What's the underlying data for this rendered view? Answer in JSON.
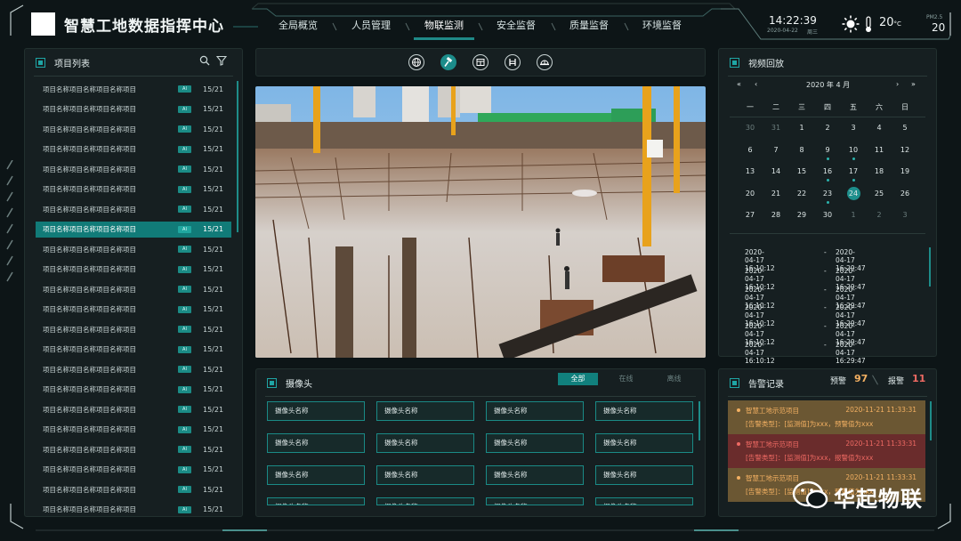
{
  "header": {
    "title": "智慧工地数据指挥中心",
    "nav": [
      "全局概览",
      "人员管理",
      "物联监测",
      "安全监督",
      "质量监督",
      "环境监督"
    ],
    "active_nav": "物联监测",
    "time": "14:22:39",
    "date": "2020-04-22",
    "weekday": "周三",
    "temperature": "20",
    "temp_unit": "°C",
    "pm_label": "PM2.5",
    "pm_value": "20",
    "icons": {
      "weather": "sun-icon",
      "temperature": "thermometer-icon"
    }
  },
  "project_list": {
    "title": "项目列表",
    "icons": [
      "search-icon",
      "filter-icon"
    ],
    "items": [
      {
        "name": "项目名称项目名称项目名称项目",
        "tag": "AI",
        "count": "15/21"
      },
      {
        "name": "项目名称项目名称项目名称项目",
        "tag": "AI",
        "count": "15/21"
      },
      {
        "name": "项目名称项目名称项目名称项目",
        "tag": "AI",
        "count": "15/21"
      },
      {
        "name": "项目名称项目名称项目名称项目",
        "tag": "AI",
        "count": "15/21"
      },
      {
        "name": "项目名称项目名称项目名称项目",
        "tag": "AI",
        "count": "15/21"
      },
      {
        "name": "项目名称项目名称项目名称项目",
        "tag": "AI",
        "count": "15/21"
      },
      {
        "name": "项目名称项目名称项目名称项目",
        "tag": "AI",
        "count": "15/21"
      },
      {
        "name": "项目名称项目名称项目名称项目",
        "tag": "AI",
        "count": "15/21",
        "selected": true
      },
      {
        "name": "项目名称项目名称项目名称项目",
        "tag": "AI",
        "count": "15/21"
      },
      {
        "name": "项目名称项目名称项目名称项目",
        "tag": "AI",
        "count": "15/21"
      },
      {
        "name": "项目名称项目名称项目名称项目",
        "tag": "AI",
        "count": "15/21"
      },
      {
        "name": "项目名称项目名称项目名称项目",
        "tag": "AI",
        "count": "15/21"
      },
      {
        "name": "项目名称项目名称项目名称项目",
        "tag": "AI",
        "count": "15/21"
      },
      {
        "name": "项目名称项目名称项目名称项目",
        "tag": "AI",
        "count": "15/21"
      },
      {
        "name": "项目名称项目名称项目名称项目",
        "tag": "AI",
        "count": "15/21"
      },
      {
        "name": "项目名称项目名称项目名称项目",
        "tag": "AI",
        "count": "15/21"
      },
      {
        "name": "项目名称项目名称项目名称项目",
        "tag": "AI",
        "count": "15/21"
      },
      {
        "name": "项目名称项目名称项目名称项目",
        "tag": "AI",
        "count": "15/21"
      },
      {
        "name": "项目名称项目名称项目名称项目",
        "tag": "AI",
        "count": "15/21"
      },
      {
        "name": "项目名称项目名称项目名称项目",
        "tag": "AI",
        "count": "15/21"
      },
      {
        "name": "项目名称项目名称项目名称项目",
        "tag": "AI",
        "count": "15/21"
      },
      {
        "name": "项目名称项目名称项目名称项目",
        "tag": "AI",
        "count": "15/21"
      }
    ]
  },
  "toolbar": {
    "buttons": [
      "globe-icon",
      "hammer-icon",
      "panel-icon",
      "barrier-icon",
      "helmet-icon"
    ],
    "active": "hammer-icon"
  },
  "video_replay": {
    "title": "视频回放",
    "month_label": "2020 年 4 月",
    "weekdays": [
      "一",
      "二",
      "三",
      "四",
      "五",
      "六",
      "日"
    ],
    "weeks": [
      [
        "30",
        "31",
        "1",
        "2",
        "3",
        "4",
        "5"
      ],
      [
        "6",
        "7",
        "8",
        "9",
        "10",
        "11",
        "12"
      ],
      [
        "13",
        "14",
        "15",
        "16",
        "17",
        "18",
        "19"
      ],
      [
        "20",
        "21",
        "22",
        "23",
        "24",
        "25",
        "26"
      ],
      [
        "27",
        "28",
        "29",
        "30",
        "1",
        "2",
        "3"
      ]
    ],
    "today": "24",
    "records": [
      {
        "start": "2020-04-17  16:10:12",
        "sep": "-",
        "end": "2020-04-17  16:29:47"
      },
      {
        "start": "2020-04-17  16:10:12",
        "sep": "-",
        "end": "2020-04-17  16:29:47"
      },
      {
        "start": "2020-04-17  16:10:12",
        "sep": "-",
        "end": "2020-04-17  16:29:47"
      },
      {
        "start": "2020-04-17  16:10:12",
        "sep": "-",
        "end": "2020-04-17  16:29:47"
      },
      {
        "start": "2020-04-17  16:10:12",
        "sep": "-",
        "end": "2020-04-17  16:29:47"
      },
      {
        "start": "2020-04-17  16:10:12",
        "sep": "-",
        "end": "2020-04-17  16:29:47"
      }
    ]
  },
  "cameras": {
    "title": "摄像头",
    "tabs": [
      "全部",
      "在线",
      "离线"
    ],
    "active_tab": "全部",
    "items": [
      "摄像头名称",
      "摄像头名称",
      "摄像头名称",
      "摄像头名称",
      "摄像头名称",
      "摄像头名称",
      "摄像头名称",
      "摄像头名称",
      "摄像头名称",
      "摄像头名称",
      "摄像头名称",
      "摄像头名称",
      "摄像头名称",
      "摄像头名称",
      "摄像头名称",
      "摄像头名称"
    ]
  },
  "alarms": {
    "title": "告警记录",
    "warn_label": "预警",
    "warn_count": "97",
    "alarm_label": "报警",
    "alarm_count": "11",
    "records": [
      {
        "level": "warn",
        "title": "智慧工地示范项目",
        "time": "2020-11-21 11:33:31",
        "desc": "[告警类型]：[监测值]为xxx，预警值为xxx"
      },
      {
        "level": "err",
        "title": "智慧工地示范项目",
        "time": "2020-11-21 11:33:31",
        "desc": "[告警类型]：[监测值]为xxx，报警值为xxx"
      },
      {
        "level": "warn",
        "title": "智慧工地示范项目",
        "time": "2020-11-21 11:33:31",
        "desc": "[告警类型]：[监测值]为xxx，预警值为xxx"
      }
    ]
  },
  "watermark": {
    "text": "华起物联"
  },
  "colors": {
    "accent": "#1f8a88",
    "background": "#0d1517",
    "panel": "#161f21",
    "warn": "#f3b062",
    "alarm": "#ef6a63"
  }
}
